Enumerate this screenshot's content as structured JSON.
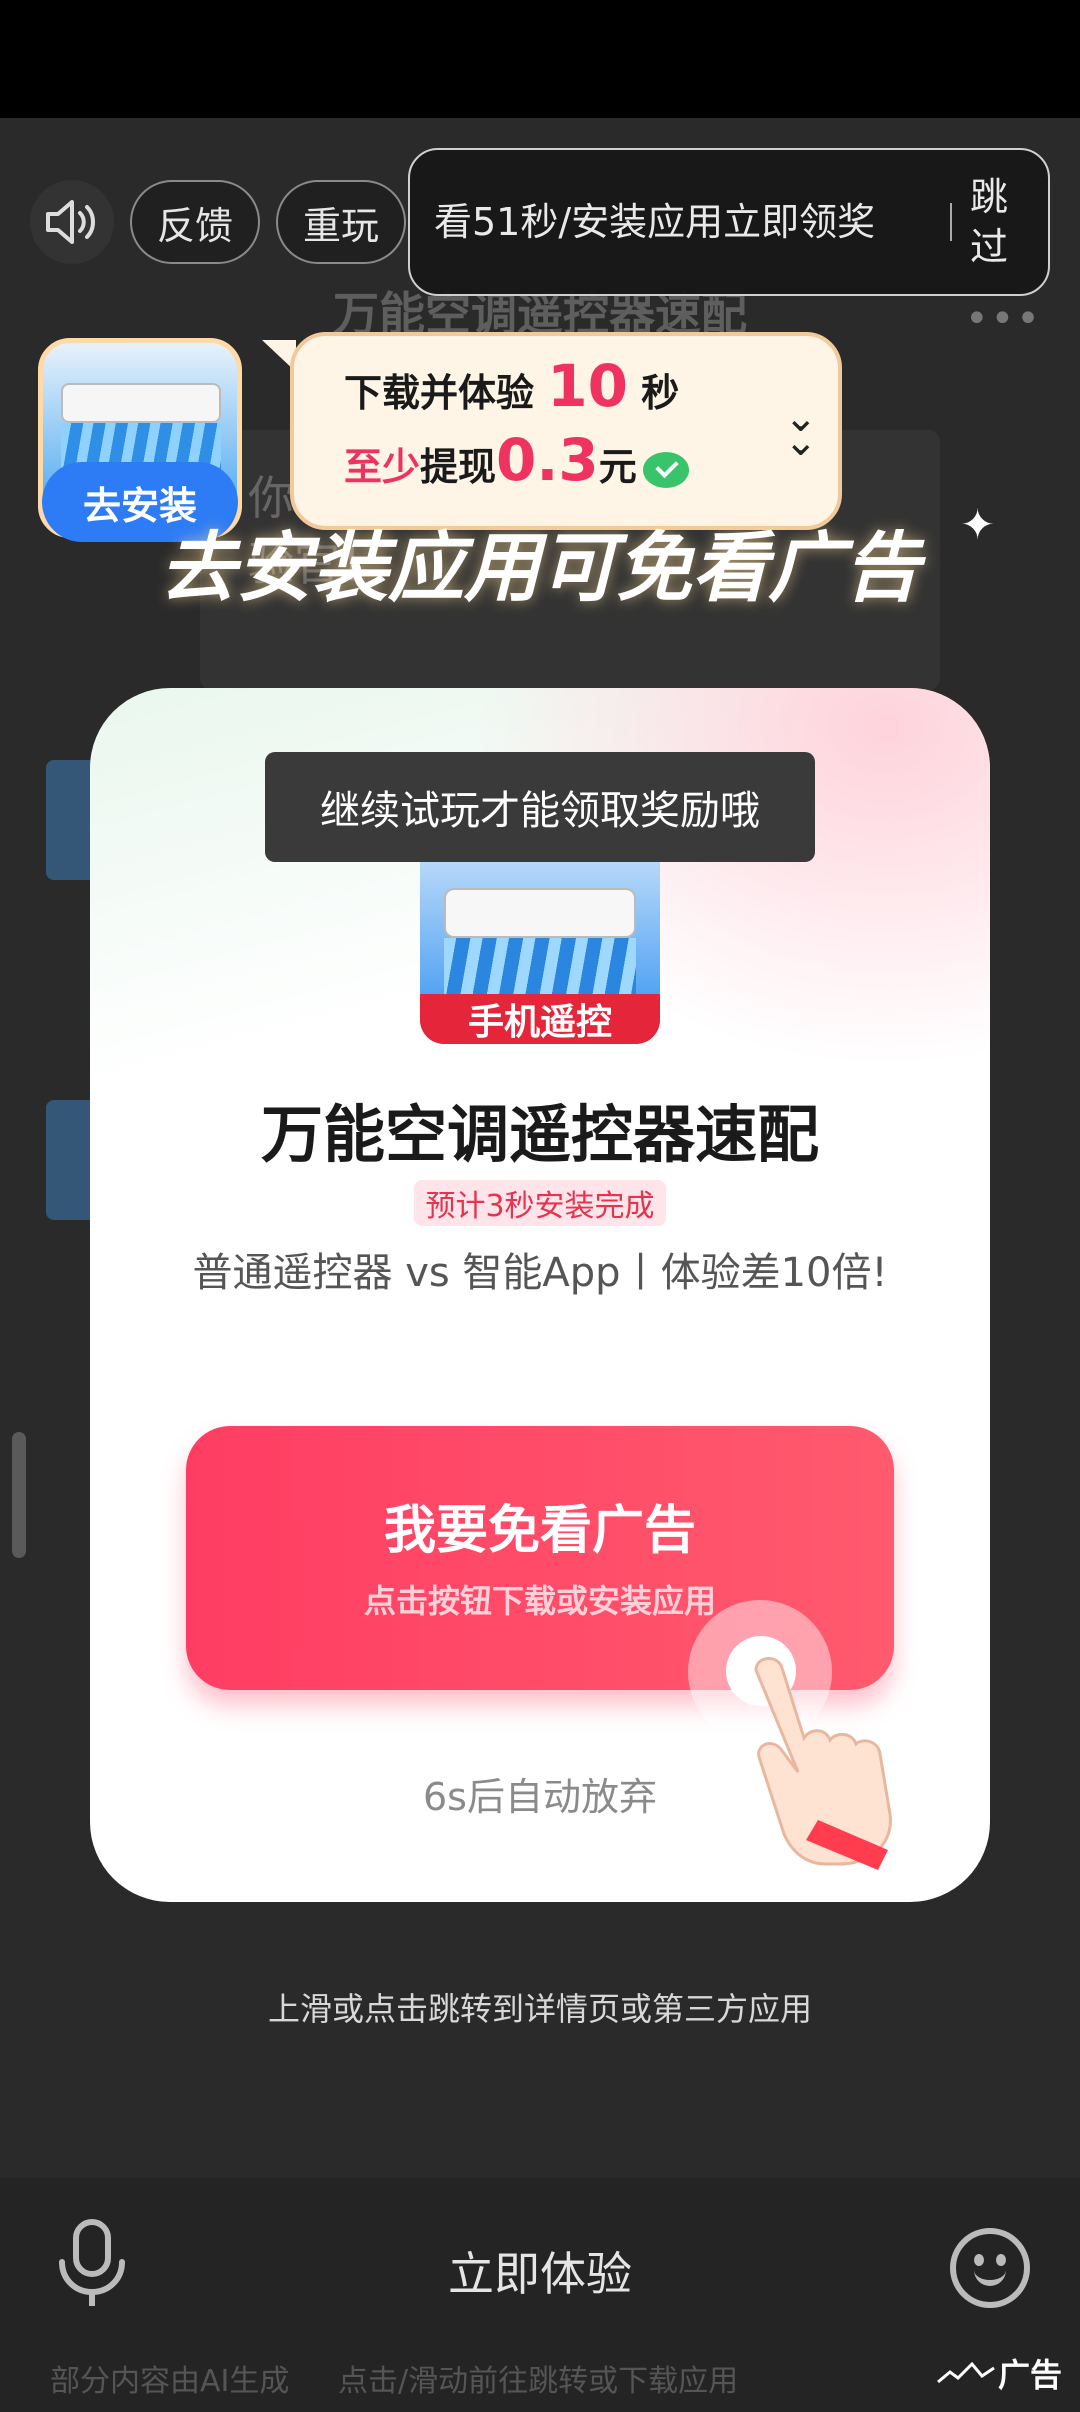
{
  "background": {
    "title": "万能空调遥控器速配",
    "more": "•••",
    "card_text": "你… 万能空调遥控器… …体验官！"
  },
  "top_controls": {
    "sound_icon": "speaker-icon",
    "feedback_label": "反馈",
    "replay_label": "重玩",
    "timer_text": "看51秒/安装应用立即领奖",
    "skip_label": "跳过"
  },
  "install_badge": {
    "button_label": "去安装",
    "bubble_line1_prefix": "下载并体验",
    "bubble_seconds": "10",
    "bubble_line1_suffix": "秒",
    "bubble_line2_prefix": "至少",
    "bubble_line2_mid": "提现",
    "bubble_amount": "0.3",
    "bubble_unit": "元",
    "headline": "去安装应用可免看广告"
  },
  "dialog": {
    "toast": "继续试玩才能领取奖励哦",
    "app_tag": "手机遥控",
    "app_name": "万能空调遥控器速配",
    "install_time": "预计3秒安装完成",
    "description": "普通遥控器 vs 智能App丨体验差10倍!",
    "cta_title": "我要免看广告",
    "cta_subtitle": "点击按钮下载或安装应用",
    "auto_abandon": "6s后自动放弃"
  },
  "swipe_hint": "上滑或点击跳转到详情页或第三方应用",
  "bottom_bar": {
    "try_now": "立即体验",
    "ai_note": "部分内容由AI生成",
    "jump_note": "点击/滑动前往跳转或下载应用",
    "ad_label": "广告"
  },
  "colors": {
    "accent": "#ff3d63",
    "install_blue": "#2d7cf5",
    "price_pink": "#ee3360"
  }
}
